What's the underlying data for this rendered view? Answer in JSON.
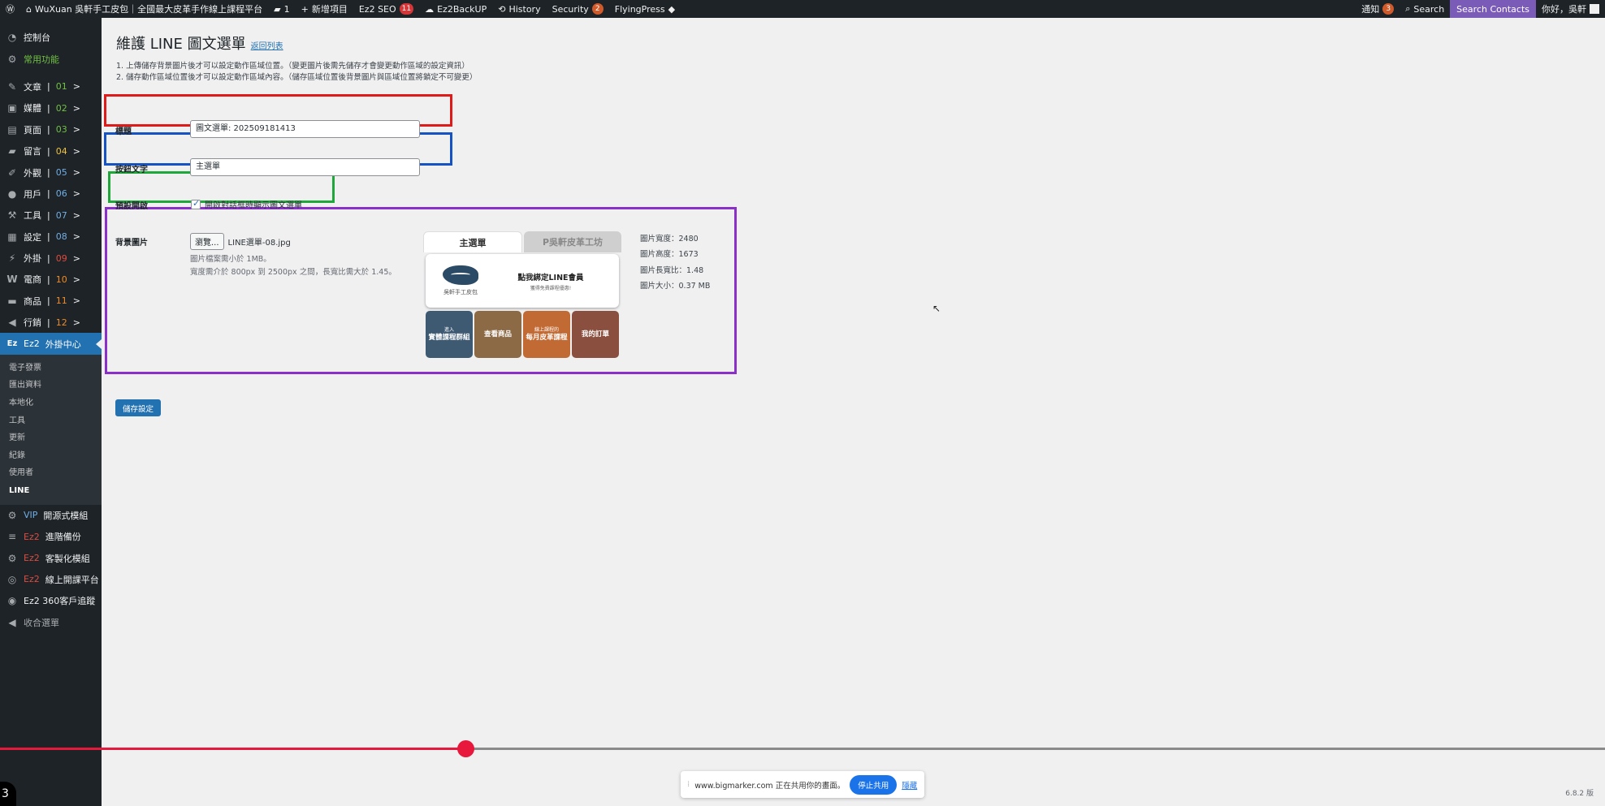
{
  "admin_bar": {
    "site_name": "WuXuan 吳軒手工皮包｜全國最大皮革手作線上課程平台",
    "comments_count": "1",
    "new_item": "新增項目",
    "seo": "Ez2 SEO",
    "seo_count": "11",
    "backup": "Ez2BackUP",
    "history": "History",
    "security": "Security",
    "security_count": "2",
    "flyingpress": "FlyingPress",
    "notifications": "通知",
    "notifications_count": "3",
    "search": "Search",
    "search_contacts": "Search Contacts",
    "greeting": "你好，吳軒"
  },
  "sidebar": {
    "dashboard": "控制台",
    "common": "常用功能",
    "posts": {
      "label": "文章",
      "num": "01"
    },
    "media": {
      "label": "媒體",
      "num": "02"
    },
    "pages": {
      "label": "頁面",
      "num": "03"
    },
    "comments": {
      "label": "留言",
      "num": "04"
    },
    "appearance": {
      "label": "外觀",
      "num": "05"
    },
    "users": {
      "label": "用戶",
      "num": "06"
    },
    "tools": {
      "label": "工具",
      "num": "07"
    },
    "settings": {
      "label": "設定",
      "num": "08"
    },
    "plugins": {
      "label": "外掛",
      "num": "09"
    },
    "woocommerce": {
      "label": "電商",
      "num": "10"
    },
    "products": {
      "label": "商品",
      "num": "11"
    },
    "marketing": {
      "label": "行銷",
      "num": "12"
    },
    "sep": "|",
    "arrow": ">",
    "ez2_center": {
      "prefix": "Ez2",
      "label": "外掛中心"
    },
    "submenu": [
      "電子發票",
      "匯出資料",
      "本地化",
      "工具",
      "更新",
      "紀錄",
      "使用者",
      "LINE"
    ],
    "vip": {
      "prefix": "VIP",
      "label": "開源式模組"
    },
    "backup_adv": {
      "prefix": "Ez2",
      "label": "進階備份"
    },
    "custom_module": {
      "prefix": "Ez2",
      "label": "客製化模組"
    },
    "online_course": {
      "prefix": "Ez2",
      "label": "線上開課平台"
    },
    "customer_tracking": "Ez2 360客戶追蹤",
    "collapse": "收合選單"
  },
  "page": {
    "title": "維護 LINE 圖文選單",
    "back_link": "返回列表",
    "note1": "1. 上傳儲存背景圖片後才可以設定動作區域位置。（變更圖片後需先儲存才會變更動作區域的設定資訊）",
    "note2": "2. 儲存動作區域位置後才可以設定動作區域內容。（儲存區域位置後背景圖片與區域位置將鎖定不可變更）",
    "title_label": "標題",
    "title_value": "圖文選單: 202509181413",
    "button_text_label": "按鈕文字",
    "button_text_value": "主選單",
    "default_open_label": "預設開啟",
    "default_open_text": "開啟對話框時顯示圖文選單",
    "bg_image_label": "背景圖片",
    "browse": "瀏覽...",
    "file_name": "LINE選單-08.jpg",
    "hint1": "圖片檔案需小於 1MB。",
    "hint2": "寬度需介於 800px 到 2500px 之間，長寬比需大於 1.45。",
    "dims": {
      "width": "圖片寬度：2480",
      "height": "圖片高度：1673",
      "ratio": "圖片長寬比：1.48",
      "size": "圖片大小：0.37 MB"
    },
    "save": "儲存設定"
  },
  "preview": {
    "tab_main": "主選單",
    "tab_studio": "P吳軒皮革工坊",
    "logo_text": "吳軒手工皮包",
    "banner_title": "點我綁定LINE會員",
    "banner_sub": "獲得免費課程優惠!",
    "tiles": [
      {
        "small": "進入",
        "label": "實體課程群組",
        "color": "#3e5a73"
      },
      {
        "small": "",
        "label": "查看商品",
        "color": "#8c6a45"
      },
      {
        "small": "線上課程的",
        "label": "每月皮革課程",
        "color": "#c26a34"
      },
      {
        "small": "",
        "label": "我的訂單",
        "color": "#8a4f3e"
      }
    ]
  },
  "share_bar": {
    "text": "www.bigmarker.com 正在共用你的畫面。",
    "stop": "停止共用",
    "hide": "隱藏"
  },
  "video": {
    "progress": 0.29
  },
  "version": "6.8.2 版",
  "corner_number": "3"
}
